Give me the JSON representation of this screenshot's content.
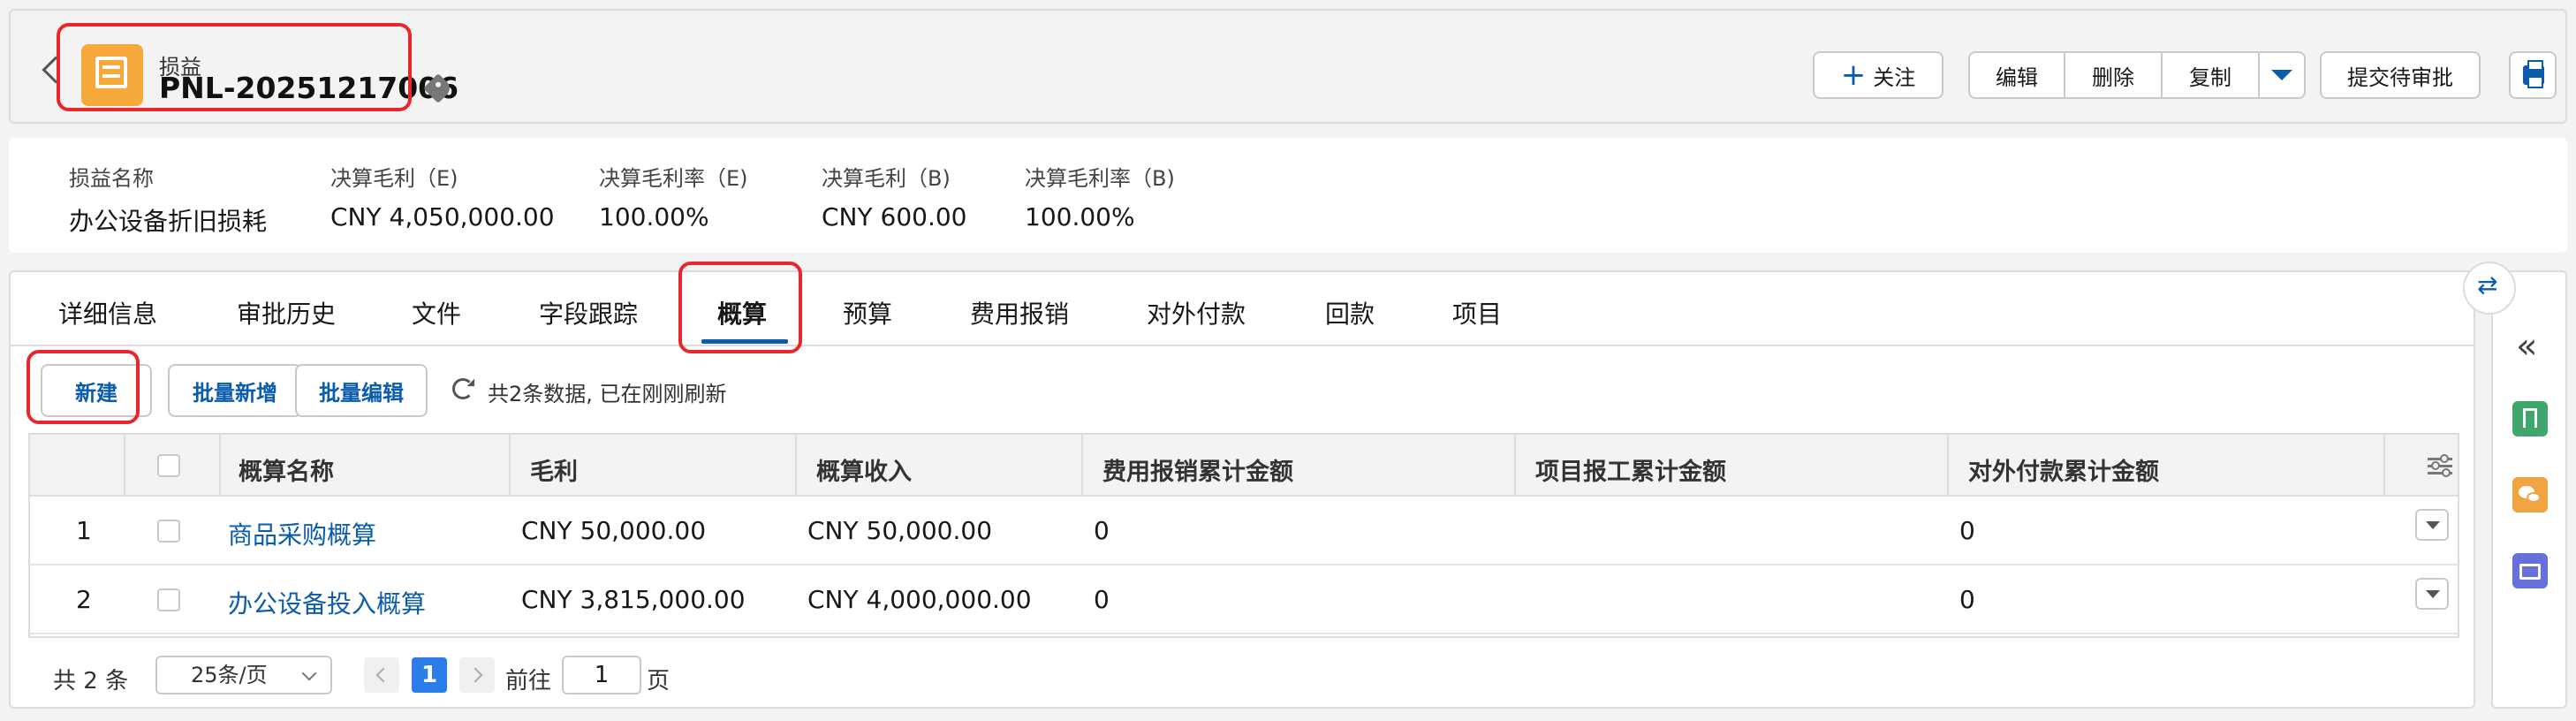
{
  "header": {
    "object_type": "损益",
    "record_id": "PNL-20251217006",
    "follow_label": "关注",
    "edit_label": "编辑",
    "delete_label": "删除",
    "copy_label": "复制",
    "submit_label": "提交待审批"
  },
  "highlights": [
    {
      "label": "损益名称",
      "value": "办公设备折旧损耗"
    },
    {
      "label": "决算毛利（E)",
      "value": "CNY 4,050,000.00"
    },
    {
      "label": "决算毛利率（E)",
      "value": "100.00%"
    },
    {
      "label": "决算毛利（B)",
      "value": "CNY 600.00"
    },
    {
      "label": "决算毛利率（B)",
      "value": "100.00%"
    }
  ],
  "tabs": [
    "详细信息",
    "审批历史",
    "文件",
    "字段跟踪",
    "概算",
    "预算",
    "费用报销",
    "对外付款",
    "回款",
    "项目"
  ],
  "active_tab": "概算",
  "toolbar": {
    "new_label": "新建",
    "batch_add_label": "批量新增",
    "batch_edit_label": "批量编辑",
    "status": "共2条数据, 已在刚刚刷新"
  },
  "table": {
    "columns": [
      "概算名称",
      "毛利",
      "概算收入",
      "费用报销累计金额",
      "项目报工累计金额",
      "对外付款累计金额"
    ],
    "rows": [
      {
        "index": "1",
        "name": "商品采购概算",
        "profit": "CNY 50,000.00",
        "income": "CNY 50,000.00",
        "expense": "0",
        "work": "",
        "payment": "0"
      },
      {
        "index": "2",
        "name": "办公设备投入概算",
        "profit": "CNY 3,815,000.00",
        "income": "CNY 4,000,000.00",
        "expense": "0",
        "work": "",
        "payment": "0"
      }
    ]
  },
  "pager": {
    "total": "共 2 条",
    "page_size": "25条/页",
    "current_page": "1",
    "goto_label": "前往",
    "goto_value": "1",
    "page_suffix": "页"
  },
  "colors": {
    "accent": "#0b5cab",
    "annotation": "#e8262b",
    "record_icon": "#f7a93c"
  },
  "icons": [
    "back-chevron-icon",
    "record-icon",
    "tag-icon",
    "plus-icon",
    "caret-down-icon",
    "printer-icon",
    "refresh-icon",
    "column-settings-icon",
    "swap-icon",
    "collapse-icon",
    "bookmark-icon",
    "wechat-icon",
    "folder-icon"
  ]
}
